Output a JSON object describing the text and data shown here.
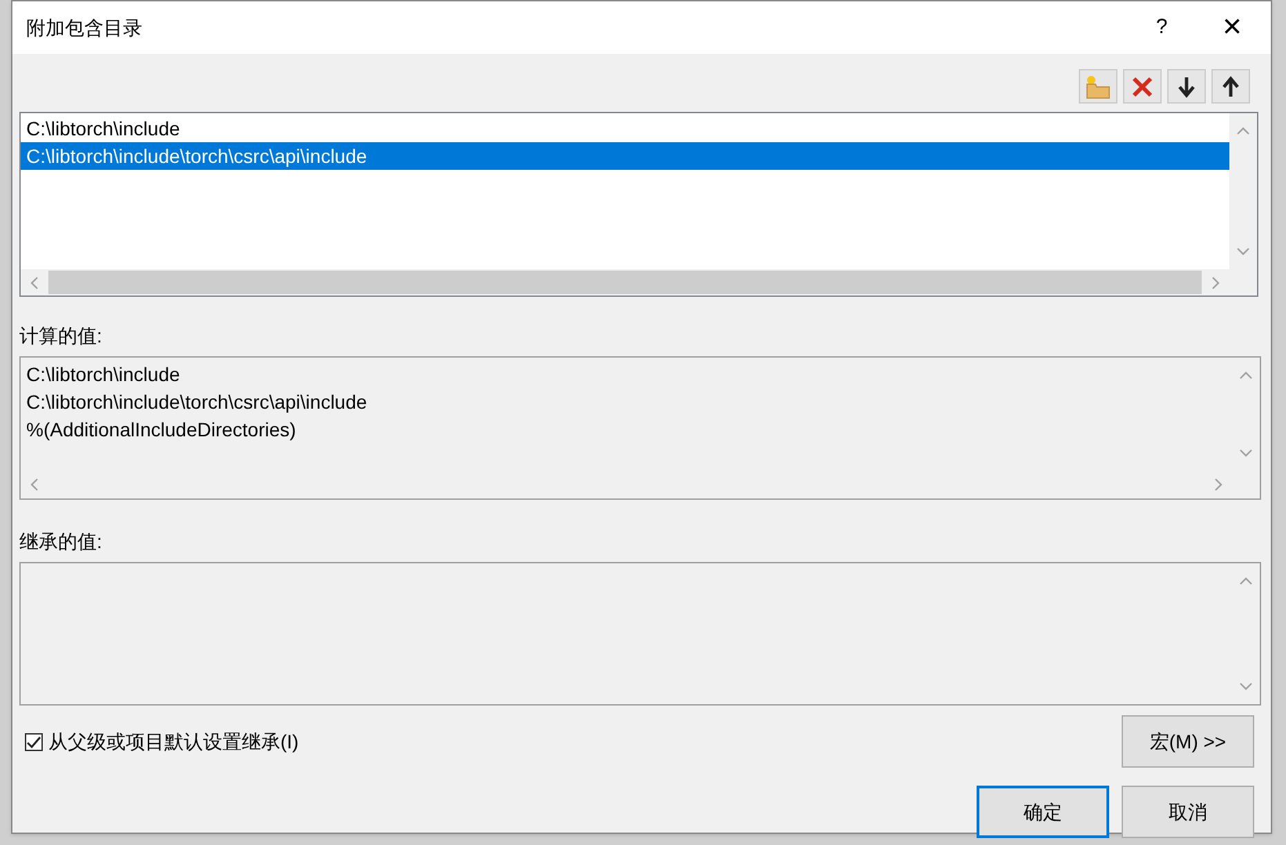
{
  "window": {
    "title": "附加包含目录",
    "help": "?",
    "close": "×"
  },
  "directories": [
    {
      "path": "C:\\libtorch\\include",
      "selected": false
    },
    {
      "path": "C:\\libtorch\\include\\torch\\csrc\\api\\include",
      "selected": true
    }
  ],
  "computed": {
    "label": "计算的值:",
    "lines": [
      "C:\\libtorch\\include",
      "C:\\libtorch\\include\\torch\\csrc\\api\\include",
      "%(AdditionalIncludeDirectories)"
    ]
  },
  "inherited": {
    "label": "继承的值:"
  },
  "inherit_checkbox": {
    "label": "从父级或项目默认设置继承(I)",
    "checked": true
  },
  "buttons": [
    {
      "label": "宏(M) >>",
      "kind": "macro"
    },
    {
      "label": "确定",
      "kind": "default"
    },
    {
      "label": "取消",
      "kind": "normal"
    }
  ]
}
